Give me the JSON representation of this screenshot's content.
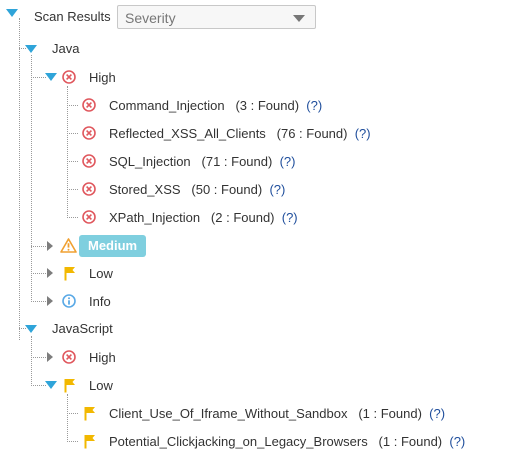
{
  "toolbar": {
    "label": "Scan Results",
    "severity_select": {
      "value": "Severity"
    }
  },
  "colors": {
    "accent": "#2fa4d9",
    "high": "#e0585e",
    "medium": "#f0a030",
    "low": "#f2b800",
    "info": "#5aa9e6",
    "badge": "#7fcfdf",
    "link": "#1f4e9c"
  },
  "tree": {
    "java": {
      "label": "Java",
      "high": {
        "label": "High",
        "items": [
          {
            "name": "Command_Injection",
            "count": "(3 : Found)",
            "help": "(?)"
          },
          {
            "name": "Reflected_XSS_All_Clients",
            "count": "(76 : Found)",
            "help": "(?)"
          },
          {
            "name": "SQL_Injection",
            "count": "(71 : Found)",
            "help": "(?)"
          },
          {
            "name": "Stored_XSS",
            "count": "(50 : Found)",
            "help": "(?)"
          },
          {
            "name": "XPath_Injection",
            "count": "(2 : Found)",
            "help": "(?)"
          }
        ]
      },
      "medium": {
        "label": "Medium"
      },
      "low": {
        "label": "Low"
      },
      "info": {
        "label": "Info"
      }
    },
    "javascript": {
      "label": "JavaScript",
      "high": {
        "label": "High"
      },
      "low": {
        "label": "Low",
        "items": [
          {
            "name": "Client_Use_Of_Iframe_Without_Sandbox",
            "count": "(1 : Found)",
            "help": "(?)"
          },
          {
            "name": "Potential_Clickjacking_on_Legacy_Browsers",
            "count": "(1 : Found)",
            "help": "(?)"
          }
        ]
      }
    }
  }
}
